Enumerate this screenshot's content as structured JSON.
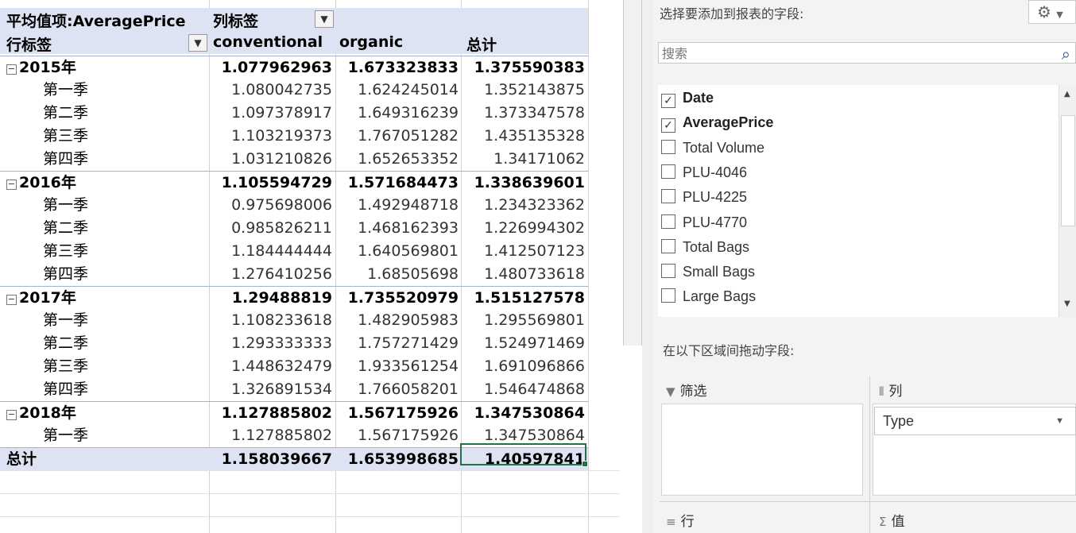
{
  "pivot": {
    "header": {
      "value_field": "平均值项:AveragePrice",
      "column_labels": "列标签",
      "row_labels": "行标签",
      "col_conventional": "conventional",
      "col_organic": "organic",
      "col_total": "总计"
    },
    "rows": [
      {
        "type": "year",
        "label": "2015年",
        "conv": "1.077962963",
        "org": "1.673323833",
        "tot": "1.375590383"
      },
      {
        "type": "quarter",
        "label": "第一季",
        "conv": "1.080042735",
        "org": "1.624245014",
        "tot": "1.352143875"
      },
      {
        "type": "quarter",
        "label": "第二季",
        "conv": "1.097378917",
        "org": "1.649316239",
        "tot": "1.373347578"
      },
      {
        "type": "quarter",
        "label": "第三季",
        "conv": "1.103219373",
        "org": "1.767051282",
        "tot": "1.435135328"
      },
      {
        "type": "quarter",
        "label": "第四季",
        "conv": "1.031210826",
        "org": "1.652653352",
        "tot": "1.34171062"
      },
      {
        "type": "year",
        "label": "2016年",
        "conv": "1.105594729",
        "org": "1.571684473",
        "tot": "1.338639601"
      },
      {
        "type": "quarter",
        "label": "第一季",
        "conv": "0.975698006",
        "org": "1.492948718",
        "tot": "1.234323362"
      },
      {
        "type": "quarter",
        "label": "第二季",
        "conv": "0.985826211",
        "org": "1.468162393",
        "tot": "1.226994302"
      },
      {
        "type": "quarter",
        "label": "第三季",
        "conv": "1.184444444",
        "org": "1.640569801",
        "tot": "1.412507123"
      },
      {
        "type": "quarter",
        "label": "第四季",
        "conv": "1.276410256",
        "org": "1.68505698",
        "tot": "1.480733618"
      },
      {
        "type": "year",
        "label": "2017年",
        "conv": "1.29488819",
        "org": "1.735520979",
        "tot": "1.515127578"
      },
      {
        "type": "quarter",
        "label": "第一季",
        "conv": "1.108233618",
        "org": "1.482905983",
        "tot": "1.295569801"
      },
      {
        "type": "quarter",
        "label": "第二季",
        "conv": "1.293333333",
        "org": "1.757271429",
        "tot": "1.524971469"
      },
      {
        "type": "quarter",
        "label": "第三季",
        "conv": "1.448632479",
        "org": "1.933561254",
        "tot": "1.691096866"
      },
      {
        "type": "quarter",
        "label": "第四季",
        "conv": "1.326891534",
        "org": "1.766058201",
        "tot": "1.546474868"
      },
      {
        "type": "year",
        "label": "2018年",
        "conv": "1.127885802",
        "org": "1.567175926",
        "tot": "1.347530864"
      },
      {
        "type": "quarter",
        "label": "第一季",
        "conv": "1.127885802",
        "org": "1.567175926",
        "tot": "1.347530864"
      }
    ],
    "grand_total": {
      "label": "总计",
      "conv": "1.158039667",
      "org": "1.653998685",
      "tot": "1.40597841"
    }
  },
  "pane": {
    "choose_fields_title": "选择要添加到报表的字段:",
    "search_placeholder": "搜索",
    "fields": [
      {
        "name": "Date",
        "checked": true
      },
      {
        "name": "AveragePrice",
        "checked": true
      },
      {
        "name": "Total Volume",
        "checked": false
      },
      {
        "name": "PLU-4046",
        "checked": false
      },
      {
        "name": "PLU-4225",
        "checked": false
      },
      {
        "name": "PLU-4770",
        "checked": false
      },
      {
        "name": "Total Bags",
        "checked": false
      },
      {
        "name": "Small Bags",
        "checked": false
      },
      {
        "name": "Large Bags",
        "checked": false
      }
    ],
    "drag_title": "在以下区域间拖动字段:",
    "areas": {
      "filter": "筛选",
      "columns": "列",
      "rows": "行",
      "values": "值"
    },
    "column_item": "Type"
  },
  "icons": {
    "expander": "collapse-minus-icon",
    "filter_dropdown": "filter-dropdown-icon",
    "search": "search-icon",
    "gear": "gear-icon"
  }
}
